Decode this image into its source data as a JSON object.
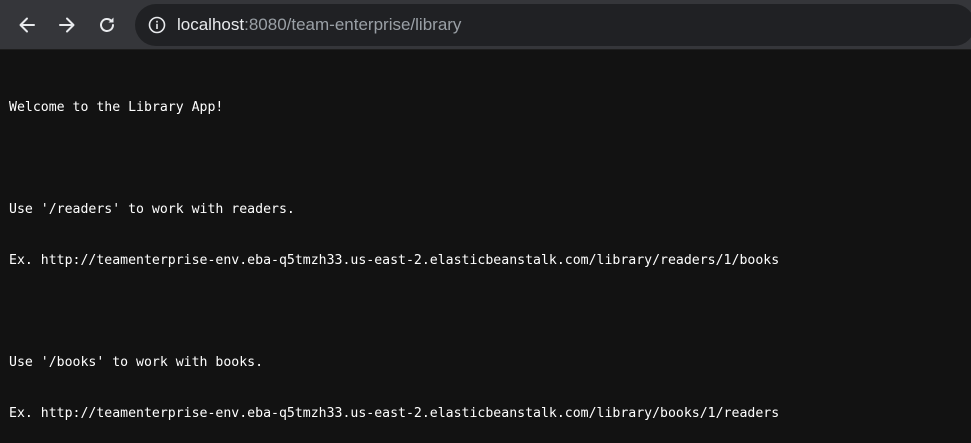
{
  "browser": {
    "toolbar": {
      "back_icon": "arrow-left-icon",
      "forward_icon": "arrow-right-icon",
      "reload_icon": "reload-icon"
    },
    "address_bar": {
      "info_icon": "info-icon",
      "host": "localhost",
      "rest": ":8080/team-enterprise/library"
    }
  },
  "page": {
    "lines": [
      "Welcome to the Library App!",
      "",
      "Use '/readers' to work with readers.",
      "Ex. http://teamenterprise-env.eba-q5tmzh33.us-east-2.elasticbeanstalk.com/library/readers/1/books",
      "",
      "Use '/books' to work with books.",
      "Ex. http://teamenterprise-env.eba-q5tmzh33.us-east-2.elasticbeanstalk.com/library/books/1/readers"
    ]
  },
  "colors": {
    "toolbar_bg": "#35363a",
    "omnibox_bg": "#202124",
    "page_bg": "#121212",
    "text": "#ffffff"
  }
}
